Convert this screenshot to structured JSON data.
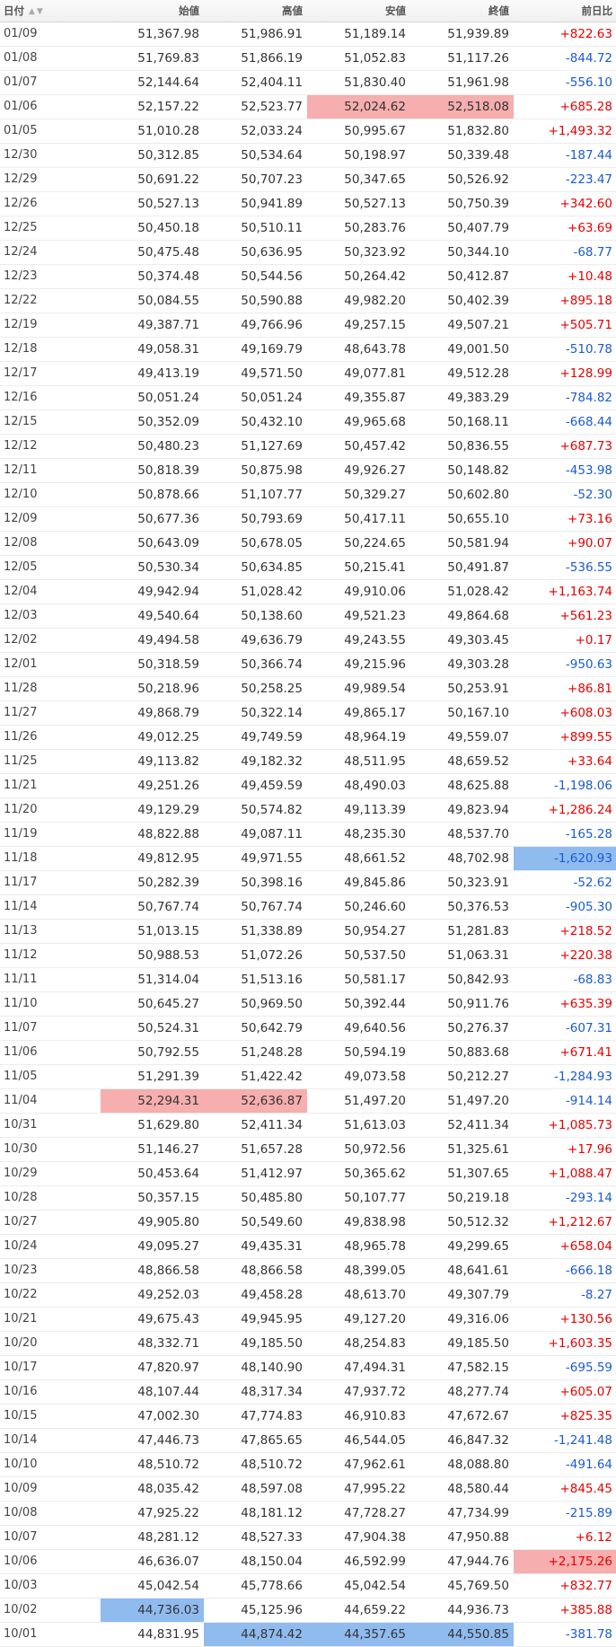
{
  "headers": {
    "date": "日付",
    "open": "始値",
    "high": "高値",
    "low": "安値",
    "close": "終値",
    "change": "前日比"
  },
  "sort_icons": [
    "sort-asc-icon",
    "sort-desc-icon"
  ],
  "colors": {
    "up": "#e60000",
    "down": "#1a5ad6",
    "highlight_max": "#f6aeae",
    "highlight_min": "#8fbbef"
  },
  "rows": [
    {
      "date": "01/09",
      "open": "51,367.98",
      "high": "51,986.91",
      "low": "51,189.14",
      "close": "51,939.89",
      "change": "+822.63"
    },
    {
      "date": "01/08",
      "open": "51,769.83",
      "high": "51,866.19",
      "low": "51,052.83",
      "close": "51,117.26",
      "change": "-844.72"
    },
    {
      "date": "01/07",
      "open": "52,144.64",
      "high": "52,404.11",
      "low": "51,830.40",
      "close": "51,961.98",
      "change": "-556.10"
    },
    {
      "date": "01/06",
      "open": "52,157.22",
      "high": "52,523.77",
      "low": "52,024.62",
      "close": "52,518.08",
      "change": "+685.28",
      "hl": {
        "low": "hi",
        "close": "hi"
      }
    },
    {
      "date": "01/05",
      "open": "51,010.28",
      "high": "52,033.24",
      "low": "50,995.67",
      "close": "51,832.80",
      "change": "+1,493.32"
    },
    {
      "date": "12/30",
      "open": "50,312.85",
      "high": "50,534.64",
      "low": "50,198.97",
      "close": "50,339.48",
      "change": "-187.44"
    },
    {
      "date": "12/29",
      "open": "50,691.22",
      "high": "50,707.23",
      "low": "50,347.65",
      "close": "50,526.92",
      "change": "-223.47"
    },
    {
      "date": "12/26",
      "open": "50,527.13",
      "high": "50,941.89",
      "low": "50,527.13",
      "close": "50,750.39",
      "change": "+342.60"
    },
    {
      "date": "12/25",
      "open": "50,450.18",
      "high": "50,510.11",
      "low": "50,283.76",
      "close": "50,407.79",
      "change": "+63.69"
    },
    {
      "date": "12/24",
      "open": "50,475.48",
      "high": "50,636.95",
      "low": "50,323.92",
      "close": "50,344.10",
      "change": "-68.77"
    },
    {
      "date": "12/23",
      "open": "50,374.48",
      "high": "50,544.56",
      "low": "50,264.42",
      "close": "50,412.87",
      "change": "+10.48"
    },
    {
      "date": "12/22",
      "open": "50,084.55",
      "high": "50,590.88",
      "low": "49,982.20",
      "close": "50,402.39",
      "change": "+895.18"
    },
    {
      "date": "12/19",
      "open": "49,387.71",
      "high": "49,766.96",
      "low": "49,257.15",
      "close": "49,507.21",
      "change": "+505.71"
    },
    {
      "date": "12/18",
      "open": "49,058.31",
      "high": "49,169.79",
      "low": "48,643.78",
      "close": "49,001.50",
      "change": "-510.78"
    },
    {
      "date": "12/17",
      "open": "49,413.19",
      "high": "49,571.50",
      "low": "49,077.81",
      "close": "49,512.28",
      "change": "+128.99"
    },
    {
      "date": "12/16",
      "open": "50,051.24",
      "high": "50,051.24",
      "low": "49,355.87",
      "close": "49,383.29",
      "change": "-784.82"
    },
    {
      "date": "12/15",
      "open": "50,352.09",
      "high": "50,432.10",
      "low": "49,965.68",
      "close": "50,168.11",
      "change": "-668.44"
    },
    {
      "date": "12/12",
      "open": "50,480.23",
      "high": "51,127.69",
      "low": "50,457.42",
      "close": "50,836.55",
      "change": "+687.73"
    },
    {
      "date": "12/11",
      "open": "50,818.39",
      "high": "50,875.98",
      "low": "49,926.27",
      "close": "50,148.82",
      "change": "-453.98"
    },
    {
      "date": "12/10",
      "open": "50,878.66",
      "high": "51,107.77",
      "low": "50,329.27",
      "close": "50,602.80",
      "change": "-52.30"
    },
    {
      "date": "12/09",
      "open": "50,677.36",
      "high": "50,793.69",
      "low": "50,417.11",
      "close": "50,655.10",
      "change": "+73.16"
    },
    {
      "date": "12/08",
      "open": "50,643.09",
      "high": "50,678.05",
      "low": "50,224.65",
      "close": "50,581.94",
      "change": "+90.07"
    },
    {
      "date": "12/05",
      "open": "50,530.34",
      "high": "50,634.85",
      "low": "50,215.41",
      "close": "50,491.87",
      "change": "-536.55"
    },
    {
      "date": "12/04",
      "open": "49,942.94",
      "high": "51,028.42",
      "low": "49,910.06",
      "close": "51,028.42",
      "change": "+1,163.74"
    },
    {
      "date": "12/03",
      "open": "49,540.64",
      "high": "50,138.60",
      "low": "49,521.23",
      "close": "49,864.68",
      "change": "+561.23"
    },
    {
      "date": "12/02",
      "open": "49,494.58",
      "high": "49,636.79",
      "low": "49,243.55",
      "close": "49,303.45",
      "change": "+0.17"
    },
    {
      "date": "12/01",
      "open": "50,318.59",
      "high": "50,366.74",
      "low": "49,215.96",
      "close": "49,303.28",
      "change": "-950.63"
    },
    {
      "date": "11/28",
      "open": "50,218.96",
      "high": "50,258.25",
      "low": "49,989.54",
      "close": "50,253.91",
      "change": "+86.81"
    },
    {
      "date": "11/27",
      "open": "49,868.79",
      "high": "50,322.14",
      "low": "49,865.17",
      "close": "50,167.10",
      "change": "+608.03"
    },
    {
      "date": "11/26",
      "open": "49,012.25",
      "high": "49,749.59",
      "low": "48,964.19",
      "close": "49,559.07",
      "change": "+899.55"
    },
    {
      "date": "11/25",
      "open": "49,113.82",
      "high": "49,182.32",
      "low": "48,511.95",
      "close": "48,659.52",
      "change": "+33.64"
    },
    {
      "date": "11/21",
      "open": "49,251.26",
      "high": "49,459.59",
      "low": "48,490.03",
      "close": "48,625.88",
      "change": "-1,198.06"
    },
    {
      "date": "11/20",
      "open": "49,129.29",
      "high": "50,574.82",
      "low": "49,113.39",
      "close": "49,823.94",
      "change": "+1,286.24"
    },
    {
      "date": "11/19",
      "open": "48,822.88",
      "high": "49,087.11",
      "low": "48,235.30",
      "close": "48,537.70",
      "change": "-165.28"
    },
    {
      "date": "11/18",
      "open": "49,812.95",
      "high": "49,971.55",
      "low": "48,661.52",
      "close": "48,702.98",
      "change": "-1,620.93",
      "hl": {
        "change": "lo"
      }
    },
    {
      "date": "11/17",
      "open": "50,282.39",
      "high": "50,398.16",
      "low": "49,845.86",
      "close": "50,323.91",
      "change": "-52.62"
    },
    {
      "date": "11/14",
      "open": "50,767.74",
      "high": "50,767.74",
      "low": "50,246.60",
      "close": "50,376.53",
      "change": "-905.30"
    },
    {
      "date": "11/13",
      "open": "51,013.15",
      "high": "51,338.89",
      "low": "50,954.27",
      "close": "51,281.83",
      "change": "+218.52"
    },
    {
      "date": "11/12",
      "open": "50,988.53",
      "high": "51,072.26",
      "low": "50,537.50",
      "close": "51,063.31",
      "change": "+220.38"
    },
    {
      "date": "11/11",
      "open": "51,314.04",
      "high": "51,513.16",
      "low": "50,581.17",
      "close": "50,842.93",
      "change": "-68.83"
    },
    {
      "date": "11/10",
      "open": "50,645.27",
      "high": "50,969.50",
      "low": "50,392.44",
      "close": "50,911.76",
      "change": "+635.39"
    },
    {
      "date": "11/07",
      "open": "50,524.31",
      "high": "50,642.79",
      "low": "49,640.56",
      "close": "50,276.37",
      "change": "-607.31"
    },
    {
      "date": "11/06",
      "open": "50,792.55",
      "high": "51,248.28",
      "low": "50,594.19",
      "close": "50,883.68",
      "change": "+671.41"
    },
    {
      "date": "11/05",
      "open": "51,291.39",
      "high": "51,422.42",
      "low": "49,073.58",
      "close": "50,212.27",
      "change": "-1,284.93"
    },
    {
      "date": "11/04",
      "open": "52,294.31",
      "high": "52,636.87",
      "low": "51,497.20",
      "close": "51,497.20",
      "change": "-914.14",
      "hl": {
        "open": "hi",
        "high": "hi"
      }
    },
    {
      "date": "10/31",
      "open": "51,629.80",
      "high": "52,411.34",
      "low": "51,613.03",
      "close": "52,411.34",
      "change": "+1,085.73"
    },
    {
      "date": "10/30",
      "open": "51,146.27",
      "high": "51,657.28",
      "low": "50,972.56",
      "close": "51,325.61",
      "change": "+17.96"
    },
    {
      "date": "10/29",
      "open": "50,453.64",
      "high": "51,412.97",
      "low": "50,365.62",
      "close": "51,307.65",
      "change": "+1,088.47"
    },
    {
      "date": "10/28",
      "open": "50,357.15",
      "high": "50,485.80",
      "low": "50,107.77",
      "close": "50,219.18",
      "change": "-293.14"
    },
    {
      "date": "10/27",
      "open": "49,905.80",
      "high": "50,549.60",
      "low": "49,838.98",
      "close": "50,512.32",
      "change": "+1,212.67"
    },
    {
      "date": "10/24",
      "open": "49,095.27",
      "high": "49,435.31",
      "low": "48,965.78",
      "close": "49,299.65",
      "change": "+658.04"
    },
    {
      "date": "10/23",
      "open": "48,866.58",
      "high": "48,866.58",
      "low": "48,399.05",
      "close": "48,641.61",
      "change": "-666.18"
    },
    {
      "date": "10/22",
      "open": "49,252.03",
      "high": "49,458.28",
      "low": "48,613.70",
      "close": "49,307.79",
      "change": "-8.27"
    },
    {
      "date": "10/21",
      "open": "49,675.43",
      "high": "49,945.95",
      "low": "49,127.20",
      "close": "49,316.06",
      "change": "+130.56"
    },
    {
      "date": "10/20",
      "open": "48,332.71",
      "high": "49,185.50",
      "low": "48,254.83",
      "close": "49,185.50",
      "change": "+1,603.35"
    },
    {
      "date": "10/17",
      "open": "47,820.97",
      "high": "48,140.90",
      "low": "47,494.31",
      "close": "47,582.15",
      "change": "-695.59"
    },
    {
      "date": "10/16",
      "open": "48,107.44",
      "high": "48,317.34",
      "low": "47,937.72",
      "close": "48,277.74",
      "change": "+605.07"
    },
    {
      "date": "10/15",
      "open": "47,002.30",
      "high": "47,774.83",
      "low": "46,910.83",
      "close": "47,672.67",
      "change": "+825.35"
    },
    {
      "date": "10/14",
      "open": "47,446.73",
      "high": "47,865.65",
      "low": "46,544.05",
      "close": "46,847.32",
      "change": "-1,241.48"
    },
    {
      "date": "10/10",
      "open": "48,510.72",
      "high": "48,510.72",
      "low": "47,962.61",
      "close": "48,088.80",
      "change": "-491.64"
    },
    {
      "date": "10/09",
      "open": "48,035.42",
      "high": "48,597.08",
      "low": "47,995.22",
      "close": "48,580.44",
      "change": "+845.45"
    },
    {
      "date": "10/08",
      "open": "47,925.22",
      "high": "48,181.12",
      "low": "47,728.27",
      "close": "47,734.99",
      "change": "-215.89"
    },
    {
      "date": "10/07",
      "open": "48,281.12",
      "high": "48,527.33",
      "low": "47,904.38",
      "close": "47,950.88",
      "change": "+6.12"
    },
    {
      "date": "10/06",
      "open": "46,636.07",
      "high": "48,150.04",
      "low": "46,592.99",
      "close": "47,944.76",
      "change": "+2,175.26",
      "hl": {
        "change": "hi"
      }
    },
    {
      "date": "10/03",
      "open": "45,042.54",
      "high": "45,778.66",
      "low": "45,042.54",
      "close": "45,769.50",
      "change": "+832.77"
    },
    {
      "date": "10/02",
      "open": "44,736.03",
      "high": "45,125.96",
      "low": "44,659.22",
      "close": "44,936.73",
      "change": "+385.88",
      "hl": {
        "open": "lo"
      }
    },
    {
      "date": "10/01",
      "open": "44,831.95",
      "high": "44,874.42",
      "low": "44,357.65",
      "close": "44,550.85",
      "change": "-381.78",
      "hl": {
        "high": "lo",
        "low": "lo",
        "close": "lo"
      }
    }
  ]
}
